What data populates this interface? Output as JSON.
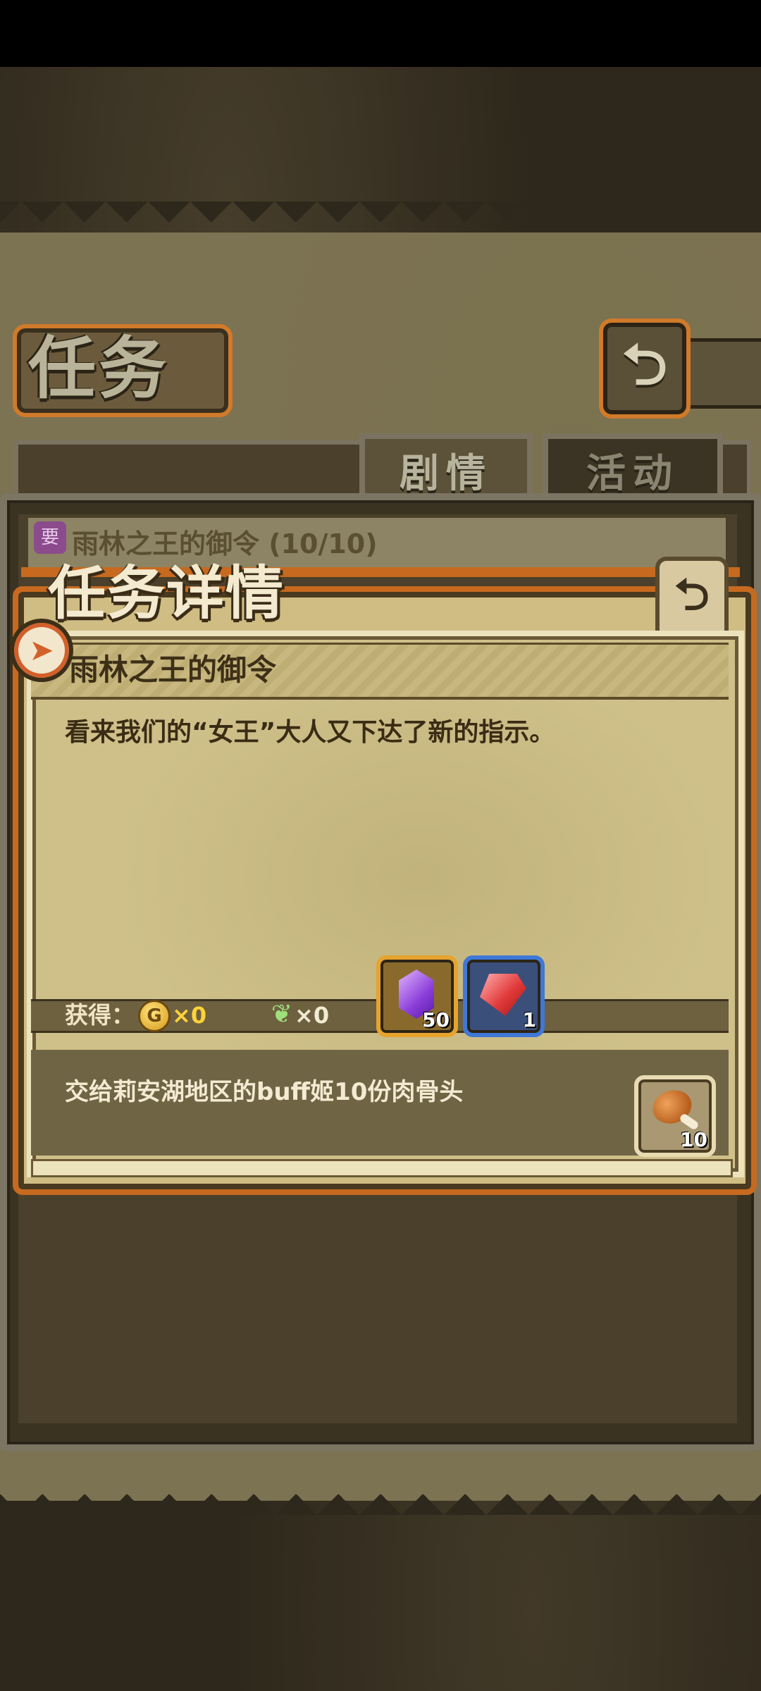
{
  "screen": {
    "title": "任务",
    "back_glyph": "⮌",
    "tabs": [
      {
        "label": "剧情",
        "active": true
      },
      {
        "label": "活动",
        "active": false
      }
    ]
  },
  "quest_list": {
    "row_title": "雨林之王的御令 (10/10)",
    "row_badge": "要"
  },
  "dialog": {
    "title": "任务详情",
    "close_glyph": "⮌",
    "quest_name": "雨林之王的御令",
    "description": "看来我们的“女王”大人又下达了新的指示。",
    "rewards": {
      "label": "获得：",
      "gold_icon_letter": "G",
      "gold": "×0",
      "feather": "×0",
      "items": [
        {
          "name": "purple-crystal",
          "count": "50",
          "frame_color": "#e6a32e"
        },
        {
          "name": "ruby-fragment",
          "count": "1",
          "frame_color": "#3f78d6"
        }
      ]
    },
    "requirement": {
      "text": "交给莉安湖地区的buff姬10份肉骨头",
      "item": {
        "name": "meat-bone",
        "count": "10"
      }
    }
  },
  "colors": {
    "accent_orange": "#c7691e",
    "gold_text": "#ffd23a",
    "parchment": "#cfc08a"
  }
}
